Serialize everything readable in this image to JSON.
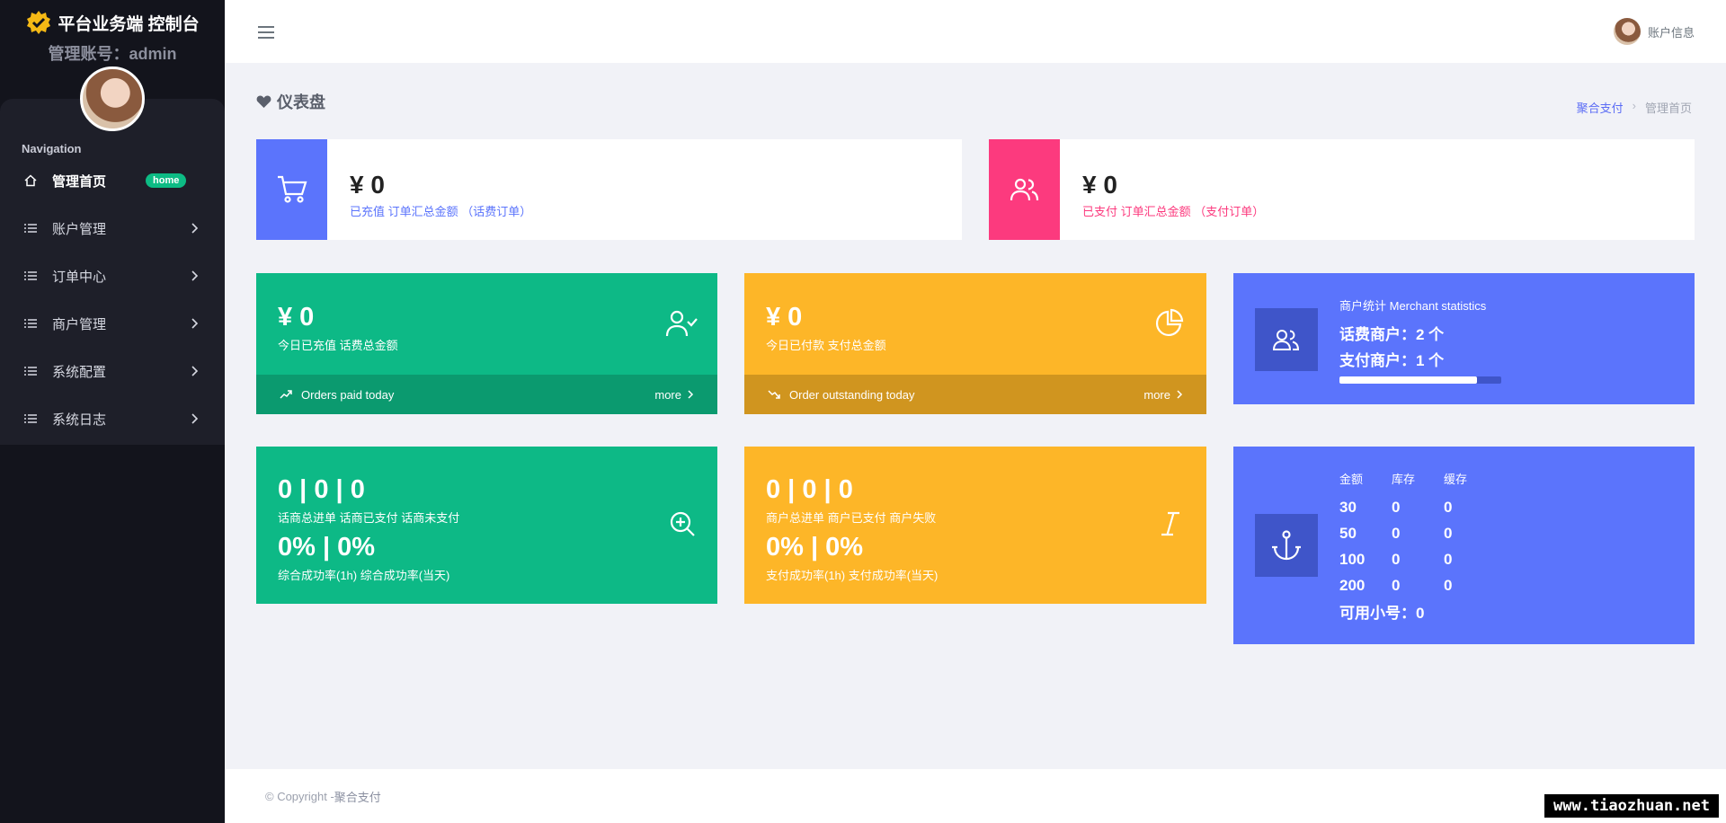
{
  "brand": {
    "title": "平台业务端 控制台",
    "account": "管理账号：admin"
  },
  "nav": {
    "heading": "Navigation",
    "items": [
      {
        "label": "管理首页",
        "badge": "home",
        "icon": "home-icon"
      },
      {
        "label": "账户管理",
        "icon": "list-icon"
      },
      {
        "label": "订单中心",
        "icon": "list-icon"
      },
      {
        "label": "商户管理",
        "icon": "list-icon"
      },
      {
        "label": "系统配置",
        "icon": "list-icon"
      },
      {
        "label": "系统日志",
        "icon": "list-icon"
      }
    ]
  },
  "topbar": {
    "account_label": "账户信息"
  },
  "page": {
    "title": "仪表盘",
    "breadcrumb": {
      "link": "聚合支付",
      "separator": "›",
      "current": "管理首页"
    }
  },
  "stats": {
    "recharged": {
      "amount": "¥ 0",
      "desc": "已充值 订单汇总金额 （话费订单）",
      "color": "#5b74fc"
    },
    "paid": {
      "amount": "¥ 0",
      "desc": "已支付 订单汇总金额 （支付订单）",
      "color": "#fc3a7e"
    }
  },
  "today_recharge": {
    "amount": "¥ 0",
    "desc": "今日已充值 话费总金额",
    "footer": "Orders paid today",
    "more": "more"
  },
  "today_pay": {
    "amount": "¥ 0",
    "desc": "今日已付款 支付总金额",
    "footer": "Order outstanding today",
    "more": "more"
  },
  "merchant": {
    "title": "商户统计 Merchant statistics",
    "phone": "话费商户：2 个",
    "pay": "支付商户：1 个",
    "progress": 0.85
  },
  "phone_orders": {
    "counts": "0 | 0 | 0",
    "count_labels": "话商总进单 话商已支付 话商未支付",
    "rates": "0% | 0%",
    "rate_labels": "综合成功率(1h) 综合成功率(当天)"
  },
  "merchant_orders": {
    "counts": "0 | 0 | 0",
    "count_labels": "商户总进单 商户已支付 商户失败",
    "rates": "0% | 0%",
    "rate_labels": "支付成功率(1h) 支付成功率(当天)"
  },
  "inventory": {
    "headers": [
      "金额",
      "库存",
      "缓存"
    ],
    "rows": [
      [
        "30",
        "0",
        "0"
      ],
      [
        "50",
        "0",
        "0"
      ],
      [
        "100",
        "0",
        "0"
      ],
      [
        "200",
        "0",
        "0"
      ]
    ],
    "available": "可用小号：0"
  },
  "footer": {
    "copyright": "© Copyright - ",
    "brand": "聚合支付"
  },
  "watermark": "www.tiaozhuan.net"
}
